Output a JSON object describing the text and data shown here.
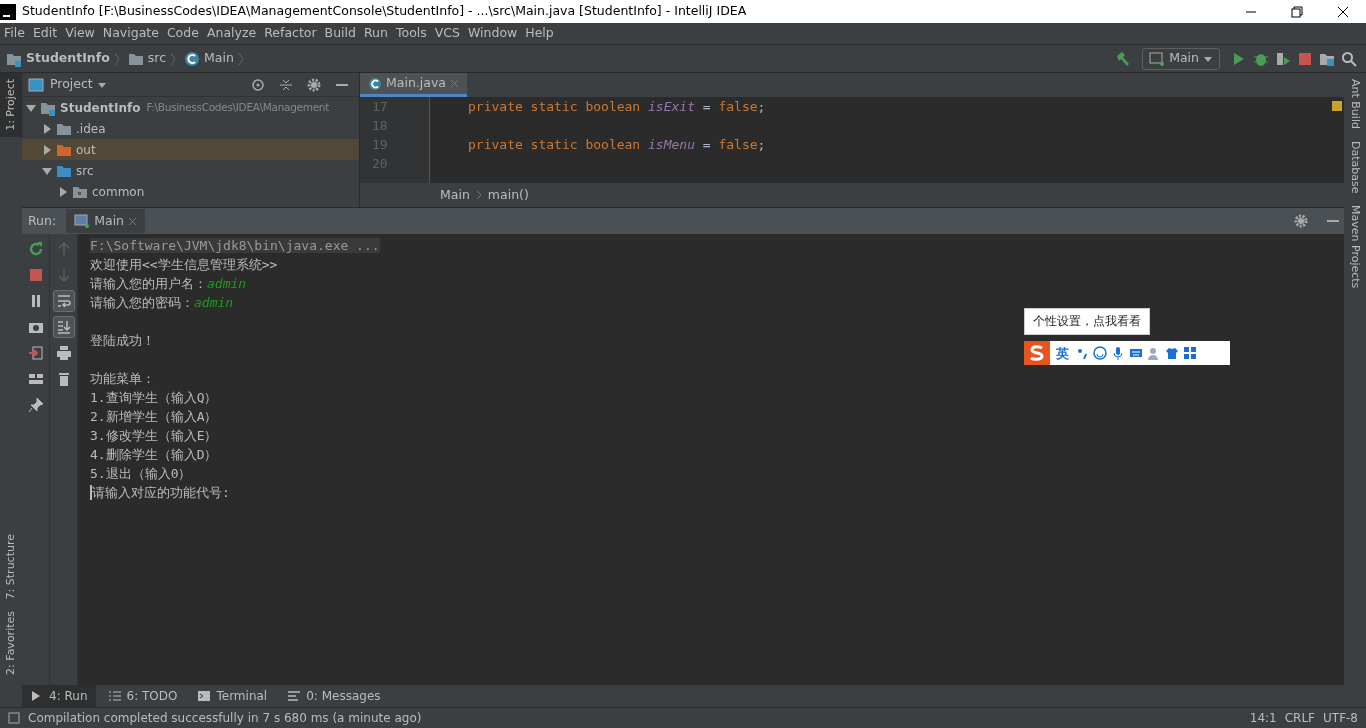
{
  "window": {
    "title": "StudentInfo [F:\\BusinessCodes\\IDEA\\ManagementConsole\\StudentInfo] - ...\\src\\Main.java [StudentInfo] - IntelliJ IDEA"
  },
  "menu": [
    "File",
    "Edit",
    "View",
    "Navigate",
    "Code",
    "Analyze",
    "Refactor",
    "Build",
    "Run",
    "Tools",
    "VCS",
    "Window",
    "Help"
  ],
  "breadcrumbs": [
    {
      "kind": "module",
      "label": "StudentInfo"
    },
    {
      "kind": "folder",
      "label": "src"
    },
    {
      "kind": "class",
      "label": "Main"
    }
  ],
  "run_config": "Main",
  "left_stripe": {
    "top": [
      {
        "label": "1: Project",
        "selected": true
      }
    ],
    "bottom": [
      {
        "label": "7: Structure",
        "selected": false
      },
      {
        "label": "2: Favorites",
        "selected": false
      }
    ]
  },
  "right_stripe": [
    "Ant Build",
    "Database",
    "Maven Projects"
  ],
  "project_panel": {
    "title": "Project",
    "tree": [
      {
        "label": "StudentInfo",
        "kind": "module",
        "hint": "F:\\BusinessCodes\\IDEA\\Management",
        "expanded": true,
        "selected": false,
        "children": [
          {
            "label": ".idea",
            "kind": "folder",
            "expanded": false,
            "selected": false
          },
          {
            "label": "out",
            "kind": "excluded",
            "expanded": false,
            "selected": true
          },
          {
            "label": "src",
            "kind": "source",
            "expanded": true,
            "selected": false,
            "children": [
              {
                "label": "common",
                "kind": "package",
                "expanded": false,
                "selected": false
              }
            ]
          }
        ]
      }
    ]
  },
  "editor": {
    "tabs": [
      {
        "label": "Main.java",
        "selected": true
      }
    ],
    "lines": [
      {
        "number": "17",
        "tokens": [
          {
            "kind": "keyword",
            "text": "private static boolean "
          },
          {
            "kind": "field",
            "text": "isExit"
          },
          {
            "kind": "plain",
            "text": " = "
          },
          {
            "kind": "keyword",
            "text": "false"
          },
          {
            "kind": "plain",
            "text": ";"
          }
        ]
      },
      {
        "number": "18"
      },
      {
        "number": "19",
        "tokens": [
          {
            "kind": "keyword",
            "text": "private static boolean "
          },
          {
            "kind": "field",
            "text": "isMenu"
          },
          {
            "kind": "plain",
            "text": " = "
          },
          {
            "kind": "keyword",
            "text": "false"
          },
          {
            "kind": "plain",
            "text": ";"
          }
        ]
      },
      {
        "number": "20"
      }
    ],
    "breadcrumbs": [
      "Main",
      "main()"
    ]
  },
  "run_panel": {
    "label": "Run:",
    "tabs": [
      {
        "label": "Main",
        "selected": true
      }
    ],
    "toolbar_left": [
      {
        "kind": "rerun"
      },
      {
        "kind": "stop"
      },
      {
        "kind": "pause"
      },
      {
        "kind": "camera"
      },
      {
        "kind": "exit"
      },
      {
        "kind": "layout"
      },
      {
        "kind": "pin"
      }
    ],
    "toolbar_right": [
      {
        "kind": "up",
        "on": false,
        "disabled": true
      },
      {
        "kind": "down",
        "on": false,
        "disabled": true
      },
      {
        "kind": "wrap",
        "on": true,
        "disabled": false
      },
      {
        "kind": "scroll",
        "on": true,
        "disabled": false
      },
      {
        "kind": "print",
        "on": false,
        "disabled": false
      },
      {
        "kind": "trash",
        "on": false,
        "disabled": false
      }
    ],
    "console": [
      {
        "kind": "command",
        "text": "F:\\Software\\JVM\\jdk8\\bin\\java.exe ..."
      },
      {
        "kind": "output",
        "text": "欢迎使用<<学生信息管理系统>>"
      },
      {
        "kind": "prompt",
        "text": "请输入您的用户名：",
        "input": "admin"
      },
      {
        "kind": "prompt",
        "text": "请输入您的密码：",
        "input": "admin"
      },
      {
        "kind": "blank"
      },
      {
        "kind": "output",
        "text": "登陆成功！"
      },
      {
        "kind": "blank"
      },
      {
        "kind": "output",
        "text": "功能菜单："
      },
      {
        "kind": "output",
        "text": "1.查询学生（输入Q）"
      },
      {
        "kind": "output",
        "text": "2.新增学生（输入A）"
      },
      {
        "kind": "output",
        "text": "3.修改学生（输入E）"
      },
      {
        "kind": "output",
        "text": "4.删除学生（输入D）"
      },
      {
        "kind": "output",
        "text": "5.退出（输入0）"
      },
      {
        "kind": "output",
        "text": "请输入对应的功能代号:",
        "cursor": true
      }
    ]
  },
  "ime": {
    "tooltip": "个性设置，点我看看",
    "mode": "英"
  },
  "tool_tabs": [
    {
      "label": "4: Run",
      "selected": true
    },
    {
      "label": "6: TODO",
      "selected": false
    },
    {
      "label": "Terminal",
      "selected": false
    },
    {
      "label": "0: Messages",
      "selected": false
    }
  ],
  "status_bar": {
    "message": "Compilation completed successfully in 7 s 680 ms (a minute ago)",
    "items": [
      "14:1",
      "CRLF",
      "UTF-8"
    ]
  }
}
